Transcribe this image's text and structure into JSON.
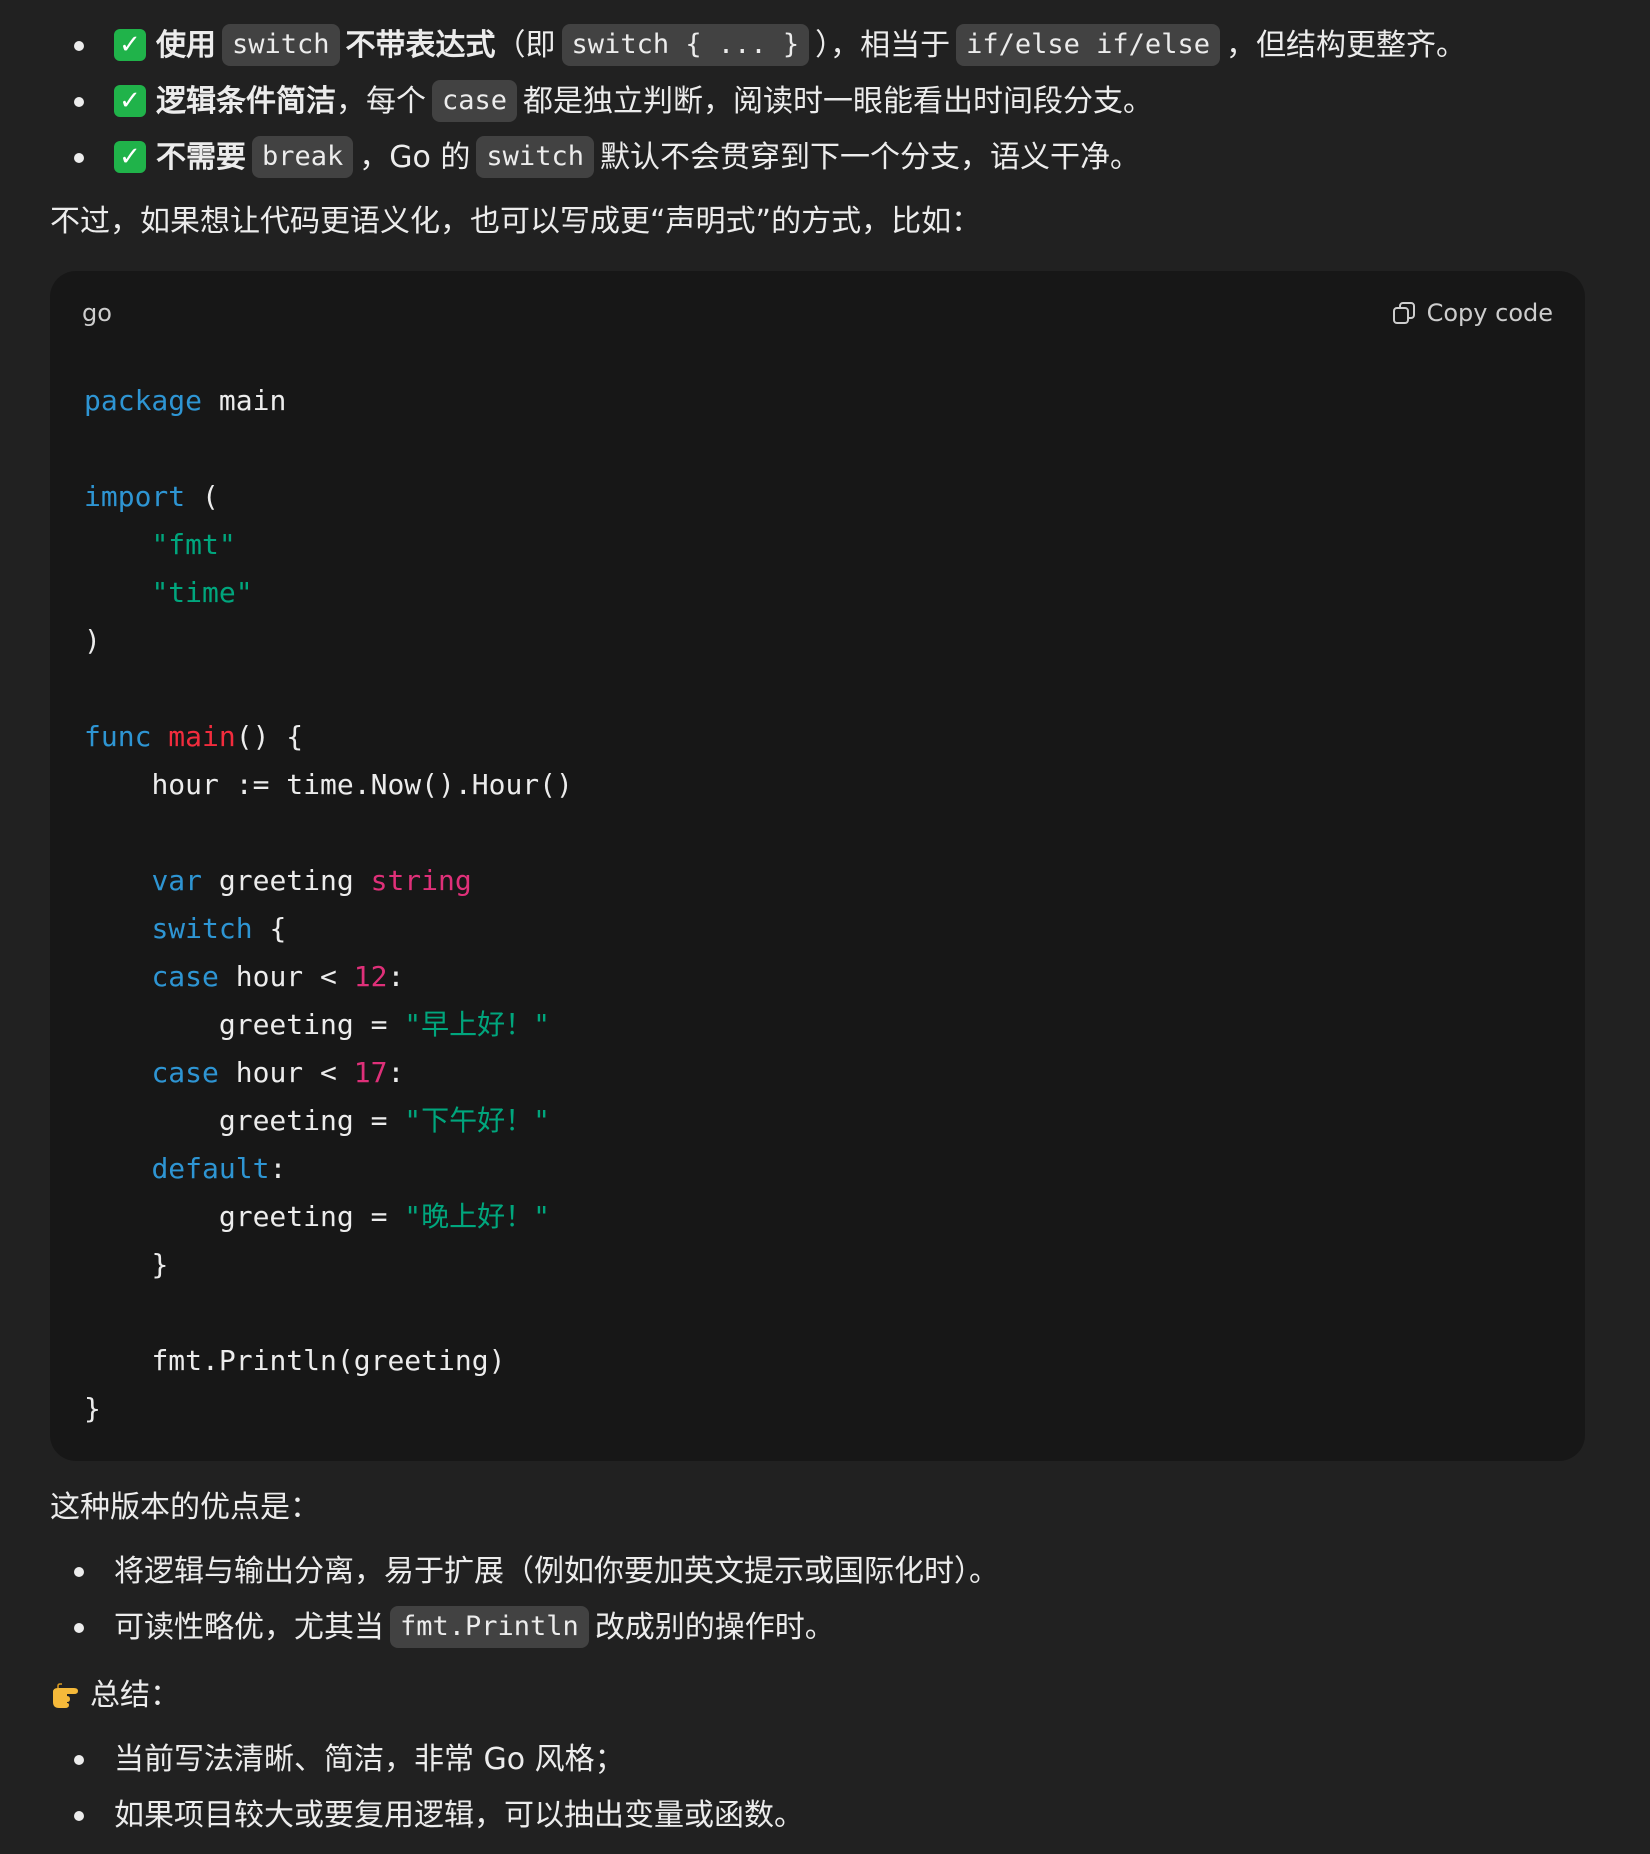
{
  "bullets_top": [
    {
      "strong": "使用",
      "code1": "switch",
      "strong2": "不带表达式",
      "text1": "（即",
      "code2": "switch { ... }",
      "text2": "），相当于",
      "code3": "if/else if/else",
      "text3": "，但结构更整齐。"
    },
    {
      "strong": "逻辑条件简洁",
      "text1": "，每个",
      "code1": "case",
      "text2": "都是独立判断，阅读时一眼能看出时间段分支。"
    },
    {
      "strong": "不需要",
      "code1": "break",
      "text1": "，Go 的",
      "code2": "switch",
      "text2": "默认不会贯穿到下一个分支，语义干净。"
    }
  ],
  "intro_text": "不过，如果想让代码更语义化，也可以写成更“声明式”的方式，比如：",
  "code_block": {
    "language": "go",
    "copy_label": "Copy code",
    "lines": {
      "l1_kw": "package",
      "l1_rest": " main",
      "l3_kw": "import",
      "l3_rest": " (",
      "l4": "\"fmt\"",
      "l5": "\"time\"",
      "l6": ")",
      "l8_kw": "func",
      "l8_fn": "main",
      "l8_rest": "() {",
      "l9": "hour := time.Now().Hour()",
      "l11_kw": "var",
      "l11_mid": " greeting ",
      "l11_ty": "string",
      "l12_kw": "switch",
      "l12_rest": " {",
      "l13_kw": "case",
      "l13_mid": " hour < ",
      "l13_num": "12",
      "l13_end": ":",
      "l14_mid": "greeting = ",
      "l14_str": "\"早上好！\"",
      "l15_kw": "case",
      "l15_mid": " hour < ",
      "l15_num": "17",
      "l15_end": ":",
      "l16_mid": "greeting = ",
      "l16_str": "\"下午好！\"",
      "l17_kw": "default",
      "l17_end": ":",
      "l18_mid": "greeting = ",
      "l18_str": "\"晚上好！\"",
      "l19": "}",
      "l21": "fmt.Println(greeting)",
      "l22": "}"
    }
  },
  "advantages_title": "这种版本的优点是：",
  "advantages": [
    {
      "text1": "将逻辑与输出分离，易于扩展（例如你要加英文提示或国际化时）。"
    },
    {
      "text1": "可读性略优，尤其当",
      "code1": "fmt.Println",
      "text2": "改成别的操作时。"
    }
  ],
  "summary_title": "总结：",
  "summary_icon": "pointing-hand-icon",
  "summary": [
    "当前写法清晰、简洁，非常 Go 风格；",
    "如果项目较大或要复用逻辑，可以抽出变量或函数。"
  ],
  "colors": {
    "background": "#212121",
    "code_bg": "#171717",
    "keyword": "#2e95d3",
    "function": "#f22c3d",
    "string": "#00a67d",
    "number": "#df3079",
    "check": "#20b34a"
  }
}
